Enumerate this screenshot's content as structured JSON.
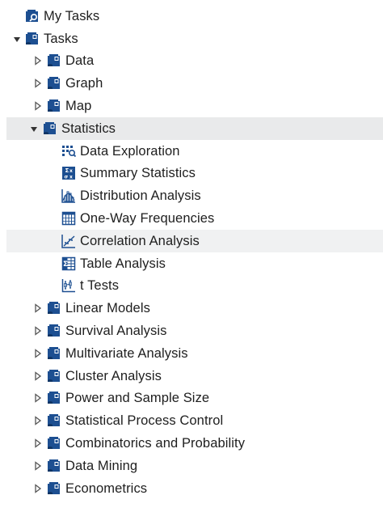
{
  "tree": {
    "root_items": [
      {
        "label": "My Tasks",
        "icon": "my-tasks-icon"
      },
      {
        "label": "Tasks",
        "icon": "folder-book-icon",
        "expanded": true
      }
    ],
    "categories_before": [
      {
        "label": "Data",
        "icon": "folder-book-icon"
      },
      {
        "label": "Graph",
        "icon": "folder-book-icon"
      },
      {
        "label": "Map",
        "icon": "folder-book-icon"
      }
    ],
    "statistics": {
      "label": "Statistics",
      "icon": "folder-book-icon",
      "expanded": true,
      "children": [
        {
          "label": "Data Exploration",
          "icon": "data-exploration-icon"
        },
        {
          "label": "Summary Statistics",
          "icon": "summary-statistics-icon"
        },
        {
          "label": "Distribution Analysis",
          "icon": "distribution-analysis-icon"
        },
        {
          "label": "One-Way Frequencies",
          "icon": "frequencies-table-icon"
        },
        {
          "label": "Correlation Analysis",
          "icon": "correlation-chart-icon"
        },
        {
          "label": "Table Analysis",
          "icon": "table-analysis-icon"
        },
        {
          "label": "t Tests",
          "icon": "t-tests-icon"
        }
      ]
    },
    "categories_after": [
      {
        "label": "Linear Models",
        "icon": "folder-book-icon"
      },
      {
        "label": "Survival Analysis",
        "icon": "folder-book-icon"
      },
      {
        "label": "Multivariate Analysis",
        "icon": "folder-book-icon"
      },
      {
        "label": "Cluster Analysis",
        "icon": "folder-book-icon"
      },
      {
        "label": "Power and Sample Size",
        "icon": "folder-book-icon"
      },
      {
        "label": "Statistical Process Control",
        "icon": "folder-book-icon"
      },
      {
        "label": "Combinatorics and Probability",
        "icon": "folder-book-icon"
      },
      {
        "label": "Data Mining",
        "icon": "folder-book-icon"
      },
      {
        "label": "Econometrics",
        "icon": "folder-book-icon"
      }
    ],
    "selected": "Statistics",
    "hovered": "Correlation Analysis"
  },
  "colors": {
    "icon_blue": "#1d4f91",
    "selected_bg": "#e9eaeb",
    "hover_bg": "#f0f1f2",
    "text": "#1e1e1e",
    "toggle": "#555555"
  }
}
